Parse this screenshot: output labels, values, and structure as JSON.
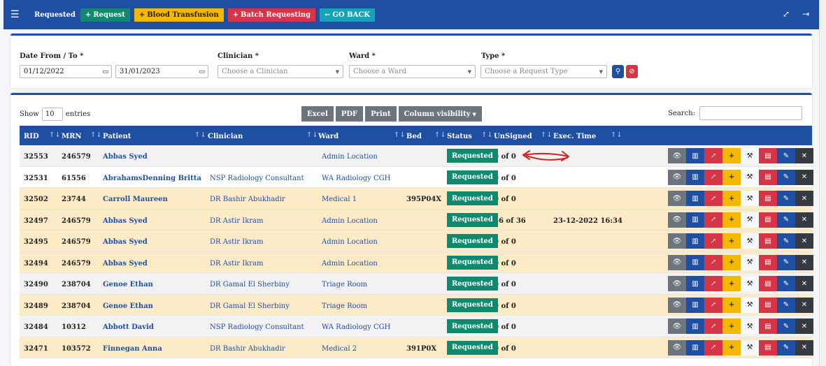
{
  "header": {
    "title": "Requested",
    "buttons": {
      "request": "Request",
      "blood": "Blood Transfusion",
      "batch": "Batch Requesting",
      "back": "GO BACK"
    }
  },
  "filters": {
    "date_label": "Date From / To *",
    "date_from": "01/12/2022",
    "date_to": "31/01/2023",
    "clinician_label": "Clinician *",
    "clinician_placeholder": "Choose a Clinician",
    "ward_label": "Ward *",
    "ward_placeholder": "Choose a Ward",
    "type_label": "Type *",
    "type_placeholder": "Choose a Request Type"
  },
  "table_controls": {
    "show": "Show",
    "entries_value": "10",
    "entries": "entries",
    "excel": "Excel",
    "pdf": "PDF",
    "print": "Print",
    "column_visibility": "Column visibility",
    "search_label": "Search:"
  },
  "columns": [
    "RID",
    "MRN",
    "Patient",
    "Clinician",
    "Ward",
    "Bed",
    "Status",
    "UnSigned",
    "Exec. Time"
  ],
  "rows": [
    {
      "rid": "32553",
      "mrn": "246579",
      "patient": "Abbas Syed",
      "clinician": "",
      "ward": "Admin Location",
      "bed": "",
      "status": "Requested",
      "unsigned": "0 of 0",
      "exec": "",
      "bg": "#f2f2f2"
    },
    {
      "rid": "32531",
      "mrn": "61556",
      "patient": "AbrahamsDenning Britta",
      "clinician": "NSP Radiology Consultant",
      "ward": "WA Radiology CGH",
      "bed": "",
      "status": "Requested",
      "unsigned": "0 of 0",
      "exec": "",
      "bg": "#ffffff"
    },
    {
      "rid": "32502",
      "mrn": "23744",
      "patient": "Carroll Maureen",
      "clinician": "DR Bashir Abukhadir",
      "ward": "Medical 1",
      "bed": "395P04X",
      "status": "Requested",
      "unsigned": "0 of 0",
      "exec": "",
      "bg": "#fcebc6"
    },
    {
      "rid": "32497",
      "mrn": "246579",
      "patient": "Abbas Syed",
      "clinician": "DR Astir Ikram",
      "ward": "Admin Location",
      "bed": "",
      "status": "Requested",
      "unsigned": "36 of 36",
      "exec": "23-12-2022 16:34",
      "bg": "#fcebc6"
    },
    {
      "rid": "32495",
      "mrn": "246579",
      "patient": "Abbas Syed",
      "clinician": "DR Astir Ikram",
      "ward": "Admin Location",
      "bed": "",
      "status": "Requested",
      "unsigned": "0 of 0",
      "exec": "",
      "bg": "#fcebc6"
    },
    {
      "rid": "32494",
      "mrn": "246579",
      "patient": "Abbas Syed",
      "clinician": "DR Astir Ikram",
      "ward": "Admin Location",
      "bed": "",
      "status": "Requested",
      "unsigned": "0 of 0",
      "exec": "",
      "bg": "#fcebc6"
    },
    {
      "rid": "32490",
      "mrn": "238704",
      "patient": "Genoe Ethan",
      "clinician": "DR Gamal El Sherbiny",
      "ward": "Triage Room",
      "bed": "",
      "status": "Requested",
      "unsigned": "0 of 0",
      "exec": "",
      "bg": "#f2f2f2"
    },
    {
      "rid": "32489",
      "mrn": "238704",
      "patient": "Genoe Ethan",
      "clinician": "DR Gamal El Sherbiny",
      "ward": "Triage Room",
      "bed": "",
      "status": "Requested",
      "unsigned": "0 of 0",
      "exec": "",
      "bg": "#fcebc6"
    },
    {
      "rid": "32484",
      "mrn": "10312",
      "patient": "Abbott David",
      "clinician": "NSP Radiology Consultant",
      "ward": "WA Radiology CGH",
      "bed": "",
      "status": "Requested",
      "unsigned": "0 of 0",
      "exec": "",
      "bg": "#f2f2f2"
    },
    {
      "rid": "32471",
      "mrn": "103572",
      "patient": "Finnegan Anna",
      "clinician": "DR Bashir Abukhadir",
      "ward": "Medical 2",
      "bed": "391P0X",
      "status": "Requested",
      "unsigned": "0 of 0",
      "exec": "",
      "bg": "#fcebc6"
    }
  ],
  "colors": {
    "primary": "#1e4fa3",
    "success": "#108a6e",
    "warning": "#f5b800",
    "danger": "#d63447",
    "info": "#17a2b8",
    "row_highlight": "#fcebc6"
  },
  "icons": [
    "menu-icon",
    "expand-icon",
    "logout-icon",
    "search-icon",
    "clear-icon",
    "view-icon",
    "chart-icon",
    "trend-icon",
    "add-icon",
    "tool-icon",
    "pdf-icon",
    "edit-icon",
    "close-icon"
  ]
}
